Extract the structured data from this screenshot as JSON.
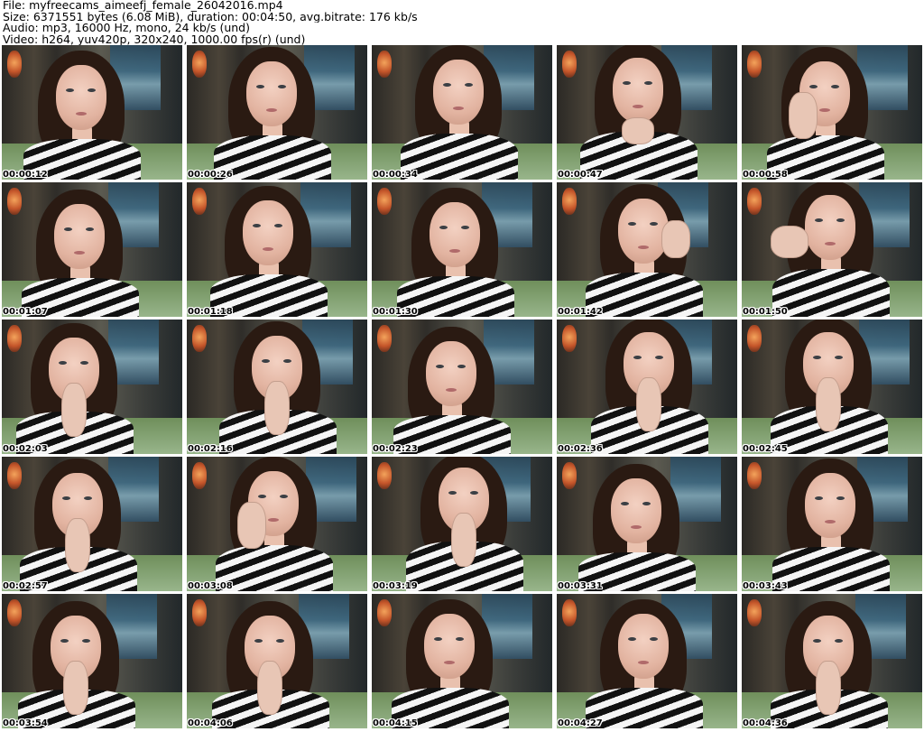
{
  "header": {
    "file_line": "File: myfreecams_aimeefj_female_26042016.mp4",
    "size_line": "Size: 6371551 bytes (6.08 MiB), duration: 00:04:50, avg.bitrate: 176 kb/s",
    "audio_line": "Audio: mp3, 16000 Hz, mono, 24 kb/s (und)",
    "video_line": "Video: h264, yuv420p, 320x240, 1000.00 fps(r) (und)"
  },
  "thumbnails": [
    {
      "timestamp": "00:00:12",
      "pose": "neutral"
    },
    {
      "timestamp": "00:00:26",
      "pose": "neutral"
    },
    {
      "timestamp": "00:00:34",
      "pose": "neutral"
    },
    {
      "timestamp": "00:00:47",
      "pose": "hand-chin"
    },
    {
      "timestamp": "00:00:58",
      "pose": "hand-cheek"
    },
    {
      "timestamp": "00:01:07",
      "pose": "neutral"
    },
    {
      "timestamp": "00:01:18",
      "pose": "neutral"
    },
    {
      "timestamp": "00:01:30",
      "pose": "neutral"
    },
    {
      "timestamp": "00:01:42",
      "pose": "arm-up"
    },
    {
      "timestamp": "00:01:50",
      "pose": "hand-hair"
    },
    {
      "timestamp": "00:02:03",
      "pose": "finger-mouth"
    },
    {
      "timestamp": "00:02:16",
      "pose": "finger-mouth"
    },
    {
      "timestamp": "00:02:23",
      "pose": "neutral"
    },
    {
      "timestamp": "00:02:36",
      "pose": "finger-mouth"
    },
    {
      "timestamp": "00:02:45",
      "pose": "finger-mouth"
    },
    {
      "timestamp": "00:02:57",
      "pose": "finger-mouth"
    },
    {
      "timestamp": "00:03:08",
      "pose": "hand-cheek"
    },
    {
      "timestamp": "00:03:19",
      "pose": "finger-mouth"
    },
    {
      "timestamp": "00:03:31",
      "pose": "neutral"
    },
    {
      "timestamp": "00:03:43",
      "pose": "neutral"
    },
    {
      "timestamp": "00:03:54",
      "pose": "finger-mouth"
    },
    {
      "timestamp": "00:04:06",
      "pose": "finger-mouth"
    },
    {
      "timestamp": "00:04:15",
      "pose": "neutral"
    },
    {
      "timestamp": "00:04:27",
      "pose": "neutral"
    },
    {
      "timestamp": "00:04:36",
      "pose": "finger-mouth"
    }
  ]
}
